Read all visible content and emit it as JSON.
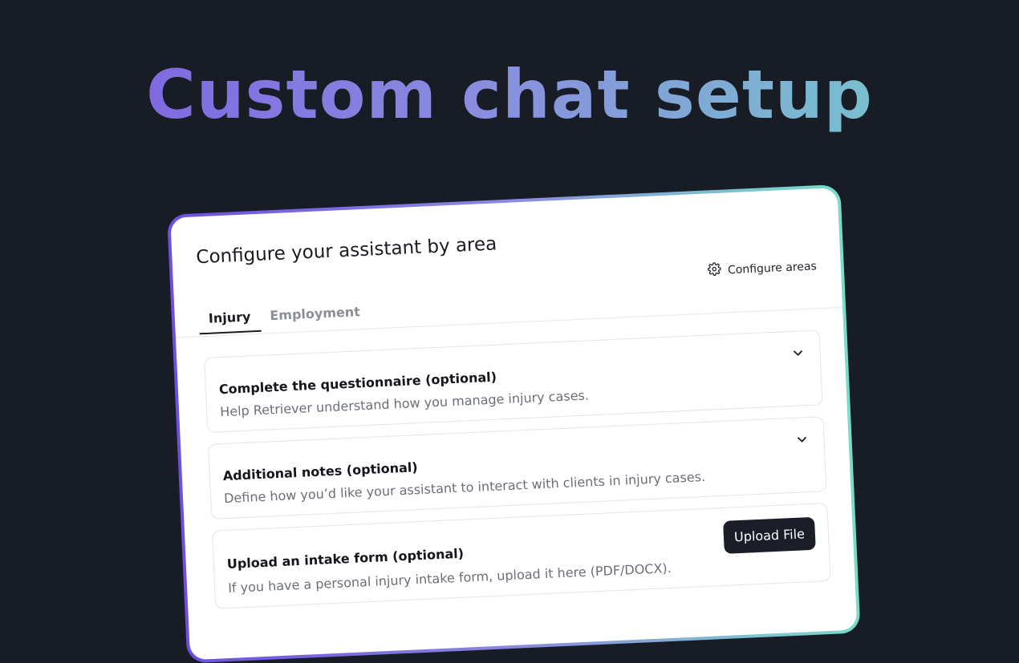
{
  "hero": {
    "title": "Custom chat setup"
  },
  "card": {
    "heading": "Configure your assistant by area",
    "configure_areas_label": "Configure areas",
    "tabs": [
      {
        "label": "Injury",
        "active": true
      },
      {
        "label": "Employment",
        "active": false
      }
    ],
    "sections": [
      {
        "title": "Complete the questionnaire (optional)",
        "description": "Help Retriever understand how you manage injury cases.",
        "control": "chevron-down-icon"
      },
      {
        "title": "Additional notes (optional)",
        "description": "Define how you’d like your assistant to interact with clients in injury cases.",
        "control": "chevron-down-icon"
      },
      {
        "title": "Upload an intake form (optional)",
        "description": "If you have a personal injury intake form, upload it here (PDF/DOCX).",
        "button_label": "Upload File"
      }
    ]
  },
  "colors": {
    "background": "#181c25",
    "gradient_start": "#7a5ce0",
    "gradient_end": "#72d2c8",
    "button": "#1b1e26"
  }
}
